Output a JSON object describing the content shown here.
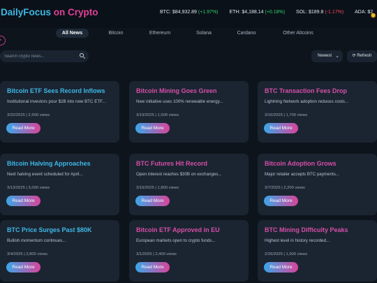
{
  "header": {
    "brand_part1": "DailyFocus",
    "brand_part2": "on Crypto",
    "ticker": [
      {
        "symbol": "BTC:",
        "price": "$84,932.89",
        "change": "(+1.97%)",
        "trend": "up"
      },
      {
        "symbol": "ETH:",
        "price": "$4,188.14",
        "change": "(+0.18%)",
        "trend": "up"
      },
      {
        "symbol": "SOL:",
        "price": "$189.8",
        "change": "(-1.17%)",
        "trend": "down"
      },
      {
        "symbol": "ADA:",
        "price": "$2",
        "change": "",
        "trend": ""
      }
    ]
  },
  "tabs": [
    "All News",
    "Bitcoin",
    "Ethereum",
    "Solana",
    "Cardano",
    "Other Altcoins"
  ],
  "active_tab": "All News",
  "search": {
    "placeholder": "Search crypto news...",
    "value": ""
  },
  "sort": {
    "selected": "Newest"
  },
  "refresh_label": "⟳ Refresh",
  "colors": {
    "accent_blue": "#3fb8e6",
    "accent_pink": "#e2409a",
    "background": "#0d141c",
    "card": "#1b2532"
  },
  "articles": [
    {
      "title": "Bitcoin ETF Sees Record Inflows",
      "excerpt": "Institutional investors pour $2B into new BTC ETF...",
      "date": "3/22/2025",
      "views": "2,500 views",
      "button": "Read More"
    },
    {
      "title": "Bitcoin Mining Goes Green",
      "excerpt": "New initiative uses 100% renewable energy...",
      "date": "3/19/2025",
      "views": "1,500 views",
      "button": "Read More"
    },
    {
      "title": "BTC Transaction Fees Drop",
      "excerpt": "Lightning Network adoption reduces costs...",
      "date": "3/16/2025",
      "views": "1,700 views",
      "button": "Read More"
    },
    {
      "title": "Bitcoin Halving Approaches",
      "excerpt": "Next halving event scheduled for April...",
      "date": "3/13/2025",
      "views": "3,000 views",
      "button": "Read More"
    },
    {
      "title": "BTC Futures Hit Record",
      "excerpt": "Open interest reaches $30B on exchanges...",
      "date": "3/10/2025",
      "views": "1,800 views",
      "button": "Read More"
    },
    {
      "title": "Bitcoin Adoption Grows",
      "excerpt": "Major retailer accepts BTC payments...",
      "date": "3/7/2025",
      "views": "2,200 views",
      "button": "Read More"
    },
    {
      "title": "BTC Price Surges Past $80K",
      "excerpt": "Bullish momentum continues...",
      "date": "3/4/2025",
      "views": "2,800 views",
      "button": "Read More"
    },
    {
      "title": "Bitcoin ETF Approved in EU",
      "excerpt": "European markets open to crypto funds...",
      "date": "3/1/2025",
      "views": "2,400 views",
      "button": "Read More"
    },
    {
      "title": "BTC Mining Difficulty Peaks",
      "excerpt": "Highest level in history recorded...",
      "date": "2/26/2025",
      "views": "1,900 views",
      "button": "Read More"
    }
  ]
}
